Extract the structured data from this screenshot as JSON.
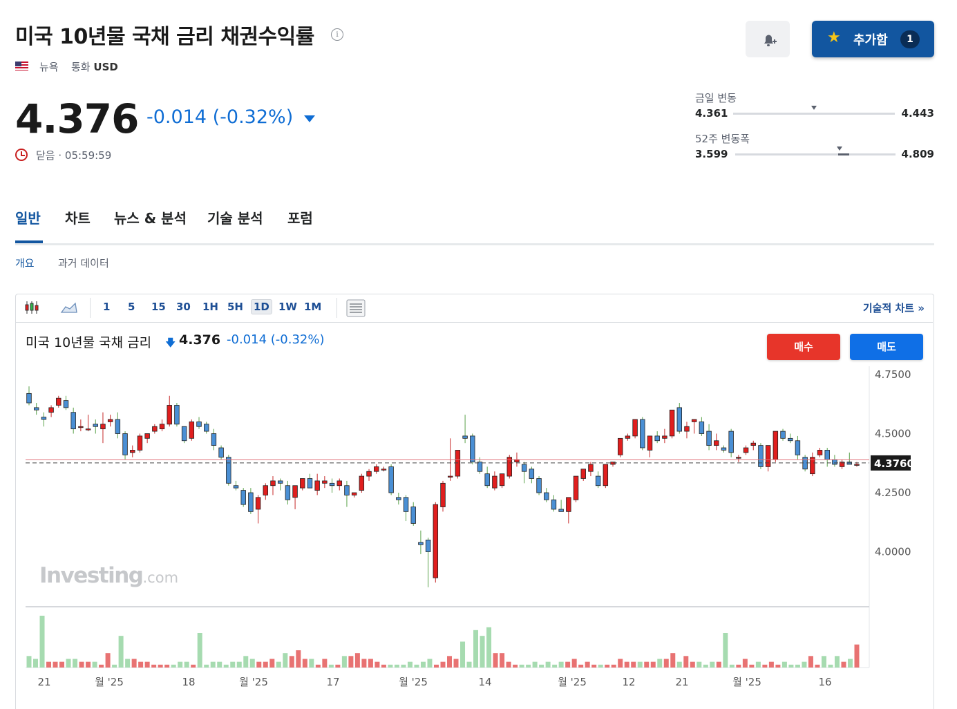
{
  "header": {
    "title": "미국 10년물 국채 금리 채권수익률",
    "exchange": "뉴욕",
    "currency_label": "통화",
    "currency": "USD",
    "add_label": "추가함",
    "add_count": "1"
  },
  "quote": {
    "price": "4.376",
    "change": "-0.014",
    "change_pct": "(-0.32%)",
    "status": "닫음 · 05:59:59"
  },
  "ranges": {
    "day": {
      "label": "금일 변동",
      "low": "4.361",
      "high": "4.443",
      "position": 0.5
    },
    "week52": {
      "label": "52주 변동폭",
      "low": "3.599",
      "high": "4.809",
      "position": 0.65
    }
  },
  "tabs": [
    "일반",
    "차트",
    "뉴스 & 분석",
    "기술 분석",
    "포럼"
  ],
  "subtabs": [
    "개요",
    "과거 데이터"
  ],
  "toolbar": {
    "intervals": [
      "1",
      "5",
      "15",
      "30",
      "1H",
      "5H",
      "1D",
      "1W",
      "1M"
    ],
    "selected": "1D",
    "tech_chart": "기술적 차트 »"
  },
  "chart_legend": {
    "name": "미국 10년물 국채 금리",
    "price": "4.376",
    "change": "-0.014",
    "change_pct": "(-0.32%)",
    "buy": "매수",
    "sell": "매도"
  },
  "watermark": {
    "brand": "Investing",
    "suffix": ".com"
  },
  "colors": {
    "up": "#e01e1e",
    "down": "#4a8fd4",
    "accent": "#1256a0",
    "change": "#0f6dd4",
    "vol_up": "#e87272",
    "vol_down": "#a6dbb0"
  },
  "chart_data": {
    "type": "candlestick",
    "y_ticks": [
      "4.7500",
      "4.5000",
      "4.2500",
      "4.0000"
    ],
    "ylim": [
      3.8,
      4.8
    ],
    "last_price_label": "4.3760",
    "last_price": 4.376,
    "x_ticks": [
      "21",
      "월 '25",
      "18",
      "월 '25",
      "17",
      "월 '25",
      "14",
      "월 '25",
      "12",
      "21",
      "월 '25",
      "16"
    ],
    "candles": [
      [
        4.67,
        4.7,
        4.62,
        4.63
      ],
      [
        4.61,
        4.63,
        4.58,
        4.6
      ],
      [
        4.57,
        4.59,
        4.53,
        4.56
      ],
      [
        4.59,
        4.62,
        4.57,
        4.61
      ],
      [
        4.62,
        4.66,
        4.61,
        4.65
      ],
      [
        4.64,
        4.66,
        4.6,
        4.61
      ],
      [
        4.59,
        4.61,
        4.5,
        4.52
      ],
      [
        4.53,
        4.56,
        4.51,
        4.53
      ],
      [
        4.52,
        4.58,
        4.51,
        4.52
      ],
      [
        4.54,
        4.56,
        4.5,
        4.53
      ],
      [
        4.52,
        4.59,
        4.46,
        4.54
      ],
      [
        4.55,
        4.58,
        4.53,
        4.56
      ],
      [
        4.56,
        4.59,
        4.48,
        4.5
      ],
      [
        4.5,
        4.51,
        4.39,
        4.41
      ],
      [
        4.42,
        4.45,
        4.4,
        4.43
      ],
      [
        4.43,
        4.5,
        4.42,
        4.49
      ],
      [
        4.48,
        4.5,
        4.46,
        4.5
      ],
      [
        4.51,
        4.54,
        4.5,
        4.53
      ],
      [
        4.52,
        4.56,
        4.51,
        4.54
      ],
      [
        4.54,
        4.66,
        4.53,
        4.62
      ],
      [
        4.62,
        4.63,
        4.53,
        4.54
      ],
      [
        4.53,
        4.53,
        4.46,
        4.47
      ],
      [
        4.48,
        4.56,
        4.47,
        4.55
      ],
      [
        4.55,
        4.57,
        4.52,
        4.53
      ],
      [
        4.54,
        4.55,
        4.5,
        4.51
      ],
      [
        4.5,
        4.52,
        4.43,
        4.45
      ],
      [
        4.44,
        4.45,
        4.39,
        4.4
      ],
      [
        4.4,
        4.41,
        4.28,
        4.29
      ],
      [
        4.28,
        4.3,
        4.26,
        4.27
      ],
      [
        4.26,
        4.27,
        4.19,
        4.2
      ],
      [
        4.25,
        4.27,
        4.16,
        4.17
      ],
      [
        4.18,
        4.24,
        4.12,
        4.23
      ],
      [
        4.24,
        4.29,
        4.22,
        4.28
      ],
      [
        4.28,
        4.32,
        4.24,
        4.3
      ],
      [
        4.3,
        4.31,
        4.26,
        4.29
      ],
      [
        4.28,
        4.3,
        4.2,
        4.22
      ],
      [
        4.23,
        4.27,
        4.18,
        4.28
      ],
      [
        4.27,
        4.31,
        4.26,
        4.31
      ],
      [
        4.31,
        4.33,
        4.27,
        4.27
      ],
      [
        4.26,
        4.33,
        4.24,
        4.3
      ],
      [
        4.29,
        4.32,
        4.27,
        4.3
      ],
      [
        4.29,
        4.31,
        4.25,
        4.28
      ],
      [
        4.28,
        4.31,
        4.26,
        4.3
      ],
      [
        4.28,
        4.3,
        4.19,
        4.24
      ],
      [
        4.24,
        4.25,
        4.23,
        4.25
      ],
      [
        4.26,
        4.33,
        4.25,
        4.32
      ],
      [
        4.32,
        4.35,
        4.3,
        4.34
      ],
      [
        4.34,
        4.37,
        4.33,
        4.36
      ],
      [
        4.35,
        4.36,
        4.34,
        4.35
      ],
      [
        4.36,
        4.37,
        4.24,
        4.25
      ],
      [
        4.23,
        4.25,
        4.2,
        4.22
      ],
      [
        4.23,
        4.24,
        4.13,
        4.17
      ],
      [
        4.19,
        4.21,
        4.11,
        4.12
      ],
      [
        4.04,
        4.09,
        3.99,
        4.03
      ],
      [
        4.05,
        4.06,
        3.85,
        4.0
      ],
      [
        3.89,
        4.21,
        3.87,
        4.2
      ],
      [
        4.19,
        4.3,
        4.17,
        4.29
      ],
      [
        4.32,
        4.48,
        4.3,
        4.32
      ],
      [
        4.32,
        4.42,
        4.31,
        4.43
      ],
      [
        4.49,
        4.58,
        4.46,
        4.48
      ],
      [
        4.49,
        4.5,
        4.37,
        4.38
      ],
      [
        4.38,
        4.4,
        4.33,
        4.34
      ],
      [
        4.33,
        4.36,
        4.27,
        4.28
      ],
      [
        4.27,
        4.34,
        4.26,
        4.32
      ],
      [
        4.28,
        4.33,
        4.27,
        4.33
      ],
      [
        4.32,
        4.41,
        4.31,
        4.4
      ],
      [
        4.38,
        4.42,
        4.36,
        4.39
      ],
      [
        4.37,
        4.38,
        4.29,
        4.34
      ],
      [
        4.35,
        4.36,
        4.29,
        4.31
      ],
      [
        4.31,
        4.32,
        4.24,
        4.25
      ],
      [
        4.25,
        4.27,
        4.21,
        4.22
      ],
      [
        4.22,
        4.24,
        4.17,
        4.18
      ],
      [
        4.18,
        4.22,
        4.17,
        4.17
      ],
      [
        4.17,
        4.23,
        4.12,
        4.23
      ],
      [
        4.22,
        4.29,
        4.21,
        4.32
      ],
      [
        4.31,
        4.35,
        4.3,
        4.35
      ],
      [
        4.34,
        4.38,
        4.32,
        4.37
      ],
      [
        4.32,
        4.34,
        4.27,
        4.28
      ],
      [
        4.28,
        4.36,
        4.27,
        4.37
      ],
      [
        4.37,
        4.38,
        4.36,
        4.38
      ],
      [
        4.41,
        4.48,
        4.4,
        4.48
      ],
      [
        4.48,
        4.5,
        4.47,
        4.49
      ],
      [
        4.49,
        4.56,
        4.48,
        4.56
      ],
      [
        4.56,
        4.57,
        4.43,
        4.44
      ],
      [
        4.43,
        4.48,
        4.4,
        4.49
      ],
      [
        4.49,
        4.51,
        4.46,
        4.47
      ],
      [
        4.48,
        4.52,
        4.46,
        4.49
      ],
      [
        4.49,
        4.6,
        4.48,
        4.6
      ],
      [
        4.61,
        4.63,
        4.5,
        4.51
      ],
      [
        4.51,
        4.55,
        4.48,
        4.53
      ],
      [
        4.55,
        4.56,
        4.5,
        4.56
      ],
      [
        4.55,
        4.57,
        4.49,
        4.5
      ],
      [
        4.51,
        4.54,
        4.43,
        4.45
      ],
      [
        4.45,
        4.5,
        4.43,
        4.47
      ],
      [
        4.44,
        4.45,
        4.42,
        4.43
      ],
      [
        4.51,
        4.52,
        4.4,
        4.42
      ],
      [
        4.4,
        4.41,
        4.38,
        4.4
      ],
      [
        4.42,
        4.45,
        4.41,
        4.44
      ],
      [
        4.45,
        4.47,
        4.43,
        4.46
      ],
      [
        4.45,
        4.46,
        4.35,
        4.36
      ],
      [
        4.36,
        4.44,
        4.34,
        4.45
      ],
      [
        4.39,
        4.51,
        4.38,
        4.51
      ],
      [
        4.51,
        4.52,
        4.47,
        4.48
      ],
      [
        4.48,
        4.5,
        4.46,
        4.47
      ],
      [
        4.47,
        4.49,
        4.39,
        4.41
      ],
      [
        4.4,
        4.41,
        4.34,
        4.35
      ],
      [
        4.33,
        4.42,
        4.32,
        4.4
      ],
      [
        4.41,
        4.44,
        4.4,
        4.43
      ],
      [
        4.43,
        4.44,
        4.36,
        4.39
      ],
      [
        4.39,
        4.41,
        4.36,
        4.37
      ],
      [
        4.36,
        4.39,
        4.35,
        4.38
      ],
      [
        4.38,
        4.42,
        4.37,
        4.37
      ],
      [
        4.37,
        4.38,
        4.36,
        4.37
      ]
    ],
    "volume": [
      4,
      3,
      18,
      2,
      2,
      2,
      3,
      3,
      2,
      2,
      2,
      1,
      5,
      1,
      11,
      3,
      3,
      2,
      2,
      1,
      1,
      1,
      1,
      2,
      2,
      1,
      12,
      1,
      2,
      2,
      1,
      2,
      2,
      4,
      3,
      2,
      2,
      3,
      2,
      5,
      4,
      6,
      3,
      3,
      1,
      3,
      1,
      1,
      4,
      4,
      5,
      3,
      3,
      2,
      1,
      1,
      1,
      1,
      2,
      1,
      2,
      3,
      1,
      2,
      4,
      3,
      9,
      2,
      13,
      11,
      14,
      5,
      5,
      2,
      1,
      1,
      1,
      2,
      1,
      2,
      1,
      2,
      2,
      3,
      1,
      2,
      1,
      1,
      1,
      1,
      3,
      2,
      2,
      2,
      2,
      2,
      3,
      3,
      5,
      2,
      4,
      2,
      2,
      1,
      2,
      2,
      12,
      1,
      1,
      3,
      1,
      2,
      1,
      2,
      1,
      2,
      1,
      1,
      2,
      4,
      1,
      4,
      1,
      4,
      2,
      3,
      8
    ]
  }
}
